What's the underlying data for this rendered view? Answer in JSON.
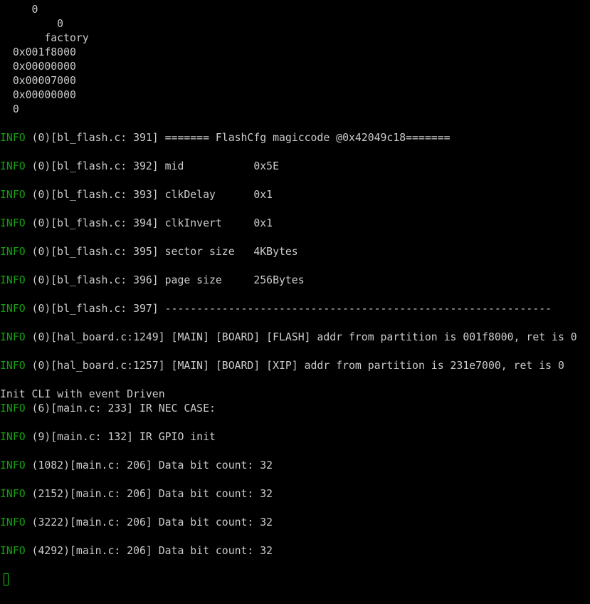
{
  "terminal": {
    "lines": [
      {
        "text": "     0"
      },
      {
        "text": "         0"
      },
      {
        "text": "       factory"
      },
      {
        "text": "  0x001f8000"
      },
      {
        "text": "  0x00000000"
      },
      {
        "text": "  0x00007000"
      },
      {
        "text": "  0x00000000"
      },
      {
        "text": "  0"
      },
      {
        "text": ""
      },
      {
        "level": "INFO",
        "text": " (0)[bl_flash.c: 391] ======= FlashCfg magiccode @0x42049c18======="
      },
      {
        "text": ""
      },
      {
        "level": "INFO",
        "text": " (0)[bl_flash.c: 392] mid           0x5E"
      },
      {
        "text": ""
      },
      {
        "level": "INFO",
        "text": " (0)[bl_flash.c: 393] clkDelay      0x1"
      },
      {
        "text": ""
      },
      {
        "level": "INFO",
        "text": " (0)[bl_flash.c: 394] clkInvert     0x1"
      },
      {
        "text": ""
      },
      {
        "level": "INFO",
        "text": " (0)[bl_flash.c: 395] sector size   4KBytes"
      },
      {
        "text": ""
      },
      {
        "level": "INFO",
        "text": " (0)[bl_flash.c: 396] page size     256Bytes"
      },
      {
        "text": ""
      },
      {
        "level": "INFO",
        "text": " (0)[bl_flash.c: 397] -------------------------------------------------------------"
      },
      {
        "text": ""
      },
      {
        "level": "INFO",
        "text": " (0)[hal_board.c:1249] [MAIN] [BOARD] [FLASH] addr from partition is 001f8000, ret is 0"
      },
      {
        "text": ""
      },
      {
        "level": "INFO",
        "text": " (0)[hal_board.c:1257] [MAIN] [BOARD] [XIP] addr from partition is 231e7000, ret is 0"
      },
      {
        "text": ""
      },
      {
        "text": "Init CLI with event Driven"
      },
      {
        "level": "INFO",
        "text": " (6)[main.c: 233] IR NEC CASE:"
      },
      {
        "text": ""
      },
      {
        "level": "INFO",
        "text": " (9)[main.c: 132] IR GPIO init"
      },
      {
        "text": ""
      },
      {
        "level": "INFO",
        "text": " (1082)[main.c: 206] Data bit count: 32"
      },
      {
        "text": ""
      },
      {
        "level": "INFO",
        "text": " (2152)[main.c: 206] Data bit count: 32"
      },
      {
        "text": ""
      },
      {
        "level": "INFO",
        "text": " (3222)[main.c: 206] Data bit count: 32"
      },
      {
        "text": ""
      },
      {
        "level": "INFO",
        "text": " (4292)[main.c: 206] Data bit count: 32"
      },
      {
        "text": ""
      }
    ]
  },
  "colors": {
    "background": "#000000",
    "foreground": "#cccccc",
    "info_level": "#13a10e",
    "cursor": "#16c60c"
  }
}
